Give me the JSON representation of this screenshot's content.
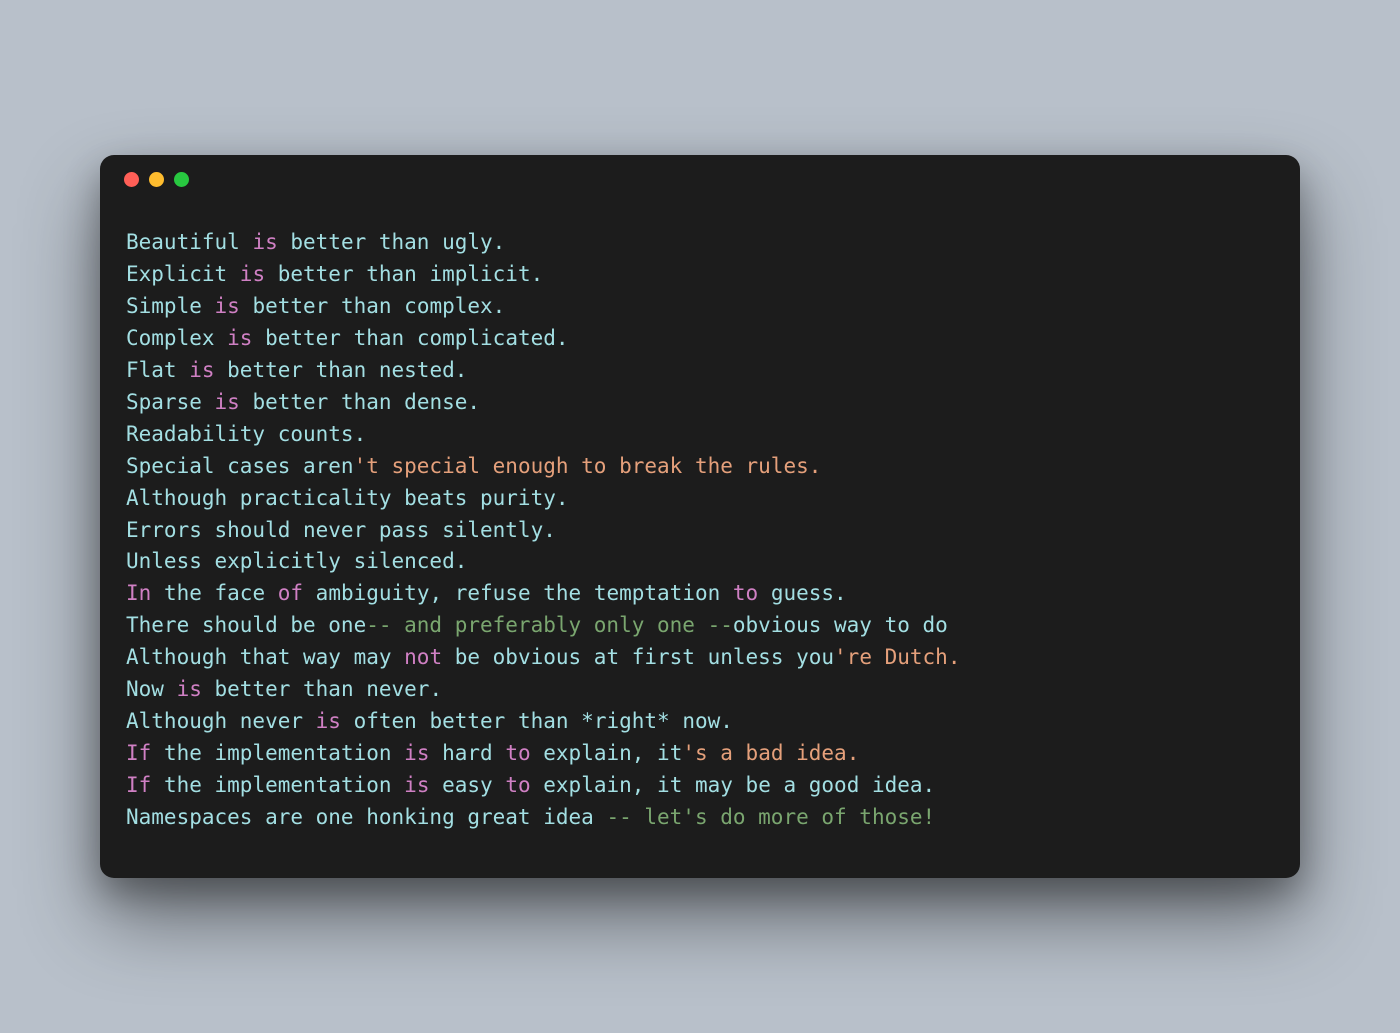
{
  "colors": {
    "bg_page": "#b8c0ca",
    "bg_window": "#1c1c1c",
    "traffic_red": "#ff5f57",
    "traffic_yellow": "#febc2e",
    "traffic_green": "#28c840",
    "tok_default": "#a3dfe3",
    "tok_keyword": "#d080c4",
    "tok_string": "#e5a07b",
    "tok_comment": "#7aa66f"
  },
  "code_lines": [
    [
      {
        "t": "Beautiful ",
        "c": "tok-default"
      },
      {
        "t": "is",
        "c": "tok-keyword"
      },
      {
        "t": " better than ugly.",
        "c": "tok-default"
      }
    ],
    [
      {
        "t": "Explicit ",
        "c": "tok-default"
      },
      {
        "t": "is",
        "c": "tok-keyword"
      },
      {
        "t": " better than implicit.",
        "c": "tok-default"
      }
    ],
    [
      {
        "t": "Simple ",
        "c": "tok-default"
      },
      {
        "t": "is",
        "c": "tok-keyword"
      },
      {
        "t": " better than complex.",
        "c": "tok-default"
      }
    ],
    [
      {
        "t": "Complex ",
        "c": "tok-default"
      },
      {
        "t": "is",
        "c": "tok-keyword"
      },
      {
        "t": " better than complicated.",
        "c": "tok-default"
      }
    ],
    [
      {
        "t": "Flat ",
        "c": "tok-default"
      },
      {
        "t": "is",
        "c": "tok-keyword"
      },
      {
        "t": " better than nested.",
        "c": "tok-default"
      }
    ],
    [
      {
        "t": "Sparse ",
        "c": "tok-default"
      },
      {
        "t": "is",
        "c": "tok-keyword"
      },
      {
        "t": " better than dense.",
        "c": "tok-default"
      }
    ],
    [
      {
        "t": "Readability counts.",
        "c": "tok-default"
      }
    ],
    [
      {
        "t": "Special cases aren",
        "c": "tok-default"
      },
      {
        "t": "'t special enough to break the rules.",
        "c": "tok-string"
      }
    ],
    [
      {
        "t": "Although practicality beats purity.",
        "c": "tok-default"
      }
    ],
    [
      {
        "t": "Errors should never pass silently.",
        "c": "tok-default"
      }
    ],
    [
      {
        "t": "Unless explicitly silenced.",
        "c": "tok-default"
      }
    ],
    [
      {
        "t": "In",
        "c": "tok-keyword"
      },
      {
        "t": " the face ",
        "c": "tok-default"
      },
      {
        "t": "of",
        "c": "tok-keyword"
      },
      {
        "t": " ambiguity, refuse the temptation ",
        "c": "tok-default"
      },
      {
        "t": "to",
        "c": "tok-keyword"
      },
      {
        "t": " guess.",
        "c": "tok-default"
      }
    ],
    [
      {
        "t": "There should be one",
        "c": "tok-default"
      },
      {
        "t": "-- and preferably only one --",
        "c": "tok-comment"
      },
      {
        "t": "obvious way to do ",
        "c": "tok-default"
      }
    ],
    [
      {
        "t": "Although that way may ",
        "c": "tok-default"
      },
      {
        "t": "not",
        "c": "tok-keyword"
      },
      {
        "t": " be obvious at first unless you",
        "c": "tok-default"
      },
      {
        "t": "'re Dutch.",
        "c": "tok-string"
      }
    ],
    [
      {
        "t": "Now ",
        "c": "tok-default"
      },
      {
        "t": "is",
        "c": "tok-keyword"
      },
      {
        "t": " better than never.",
        "c": "tok-default"
      }
    ],
    [
      {
        "t": "Although never ",
        "c": "tok-default"
      },
      {
        "t": "is",
        "c": "tok-keyword"
      },
      {
        "t": " often better than *right* now.",
        "c": "tok-default"
      }
    ],
    [
      {
        "t": "If",
        "c": "tok-keyword"
      },
      {
        "t": " the implementation ",
        "c": "tok-default"
      },
      {
        "t": "is",
        "c": "tok-keyword"
      },
      {
        "t": " hard ",
        "c": "tok-default"
      },
      {
        "t": "to",
        "c": "tok-keyword"
      },
      {
        "t": " explain, it",
        "c": "tok-default"
      },
      {
        "t": "'s a bad idea.",
        "c": "tok-string"
      }
    ],
    [
      {
        "t": "If",
        "c": "tok-keyword"
      },
      {
        "t": " the implementation ",
        "c": "tok-default"
      },
      {
        "t": "is",
        "c": "tok-keyword"
      },
      {
        "t": " easy ",
        "c": "tok-default"
      },
      {
        "t": "to",
        "c": "tok-keyword"
      },
      {
        "t": " explain, it may be a good idea.",
        "c": "tok-default"
      }
    ],
    [
      {
        "t": "Namespaces are one honking great idea ",
        "c": "tok-default"
      },
      {
        "t": "-- let's do more of those!",
        "c": "tok-comment"
      }
    ]
  ]
}
